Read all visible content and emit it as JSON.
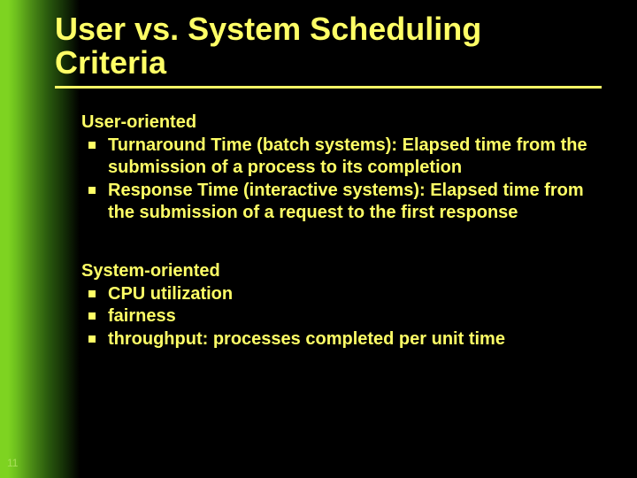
{
  "title_line1": "User vs. System Scheduling",
  "title_line2": "Criteria",
  "section1": {
    "head": "User-oriented",
    "bullets": [
      "Turnaround Time (batch systems): Elapsed time from the submission of a process to its completion",
      "Response Time (interactive systems): Elapsed time from the submission of a request to the first response"
    ]
  },
  "section2": {
    "head": "System-oriented",
    "bullets": [
      "CPU utilization",
      "fairness",
      "throughput: processes completed per unit time"
    ]
  },
  "page_number": "11"
}
